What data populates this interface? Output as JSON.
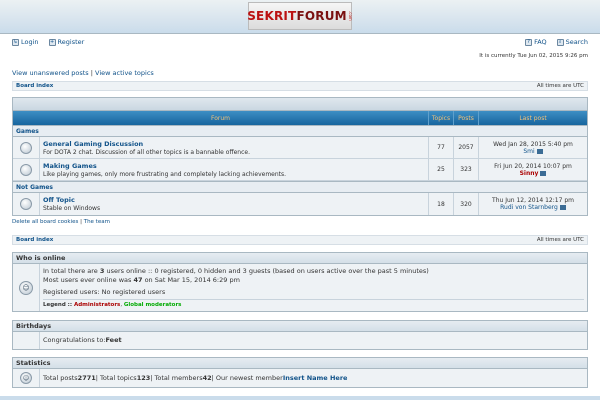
{
  "logo": {
    "main_a": "SEKRIT",
    "main_b": "FORUM",
    "tld": ".com"
  },
  "nav": {
    "login": "Login",
    "register": "Register",
    "faq": "FAQ",
    "search": "Search"
  },
  "current_time": "It is currently Tue Jun 02, 2015 9:26 pm",
  "quicklinks": {
    "unanswered": "View unanswered posts",
    "sep": "|",
    "active": "View active topics"
  },
  "breadcrumb": {
    "board_index": "Board index",
    "times": "All times are UTC"
  },
  "table_headers": {
    "forum": "Forum",
    "topics": "Topics",
    "posts": "Posts",
    "last_post": "Last post"
  },
  "categories": [
    {
      "name": "Games",
      "forums": [
        {
          "title": "General Gaming Discussion",
          "desc": "For DOTA 2 chat. Discussion of all other topics is a bannable offence.",
          "topics": "77",
          "posts": "2057",
          "last_date": "Wed Jan 28, 2015 5:40 pm",
          "last_by": "Smi"
        },
        {
          "title": "Making Games",
          "desc": "Like playing games, only more frustrating and completely lacking achievements.",
          "topics": "25",
          "posts": "323",
          "last_date": "Fri Jun 20, 2014 10:07 pm",
          "last_by": "Sinny"
        }
      ]
    },
    {
      "name": "Not Games",
      "forums": [
        {
          "title": "Off Topic",
          "desc": "Stable on Windows",
          "topics": "18",
          "posts": "320",
          "last_date": "Thu Jun 12, 2014 12:17 pm",
          "last_by": "Rudi von Starnberg"
        }
      ]
    }
  ],
  "footer_links": {
    "delete_cookies": "Delete all board cookies",
    "sep": "|",
    "team": "The team"
  },
  "who_online": {
    "title": "Who is online",
    "line1_a": "In total there are ",
    "line1_count": "3",
    "line1_b": " users online :: 0 registered, 0 hidden and 3 guests (based on users active over the past 5 minutes)",
    "line2_a": "Most users ever online was ",
    "line2_count": "47",
    "line2_b": " on Sat Mar 15, 2014 6:29 pm",
    "line3": "Registered users: No registered users",
    "legend_label": "Legend :: ",
    "legend_admin": "Administrators",
    "legend_sep": ", ",
    "legend_gmod": "Global moderators"
  },
  "birthdays": {
    "title": "Birthdays",
    "text": "Congratulations to: ",
    "name": "Feet"
  },
  "statistics": {
    "title": "Statistics",
    "a": "Total posts ",
    "posts": "2771",
    "b": " | Total topics ",
    "topics": "123",
    "c": " | Total members ",
    "members": "42",
    "d": " | Our newest member ",
    "newest": "Insert Name Here"
  },
  "colors": {
    "header_blue": "#17659e",
    "link": "#105289",
    "admin": "#aa0000",
    "gmod": "#00aa00"
  }
}
